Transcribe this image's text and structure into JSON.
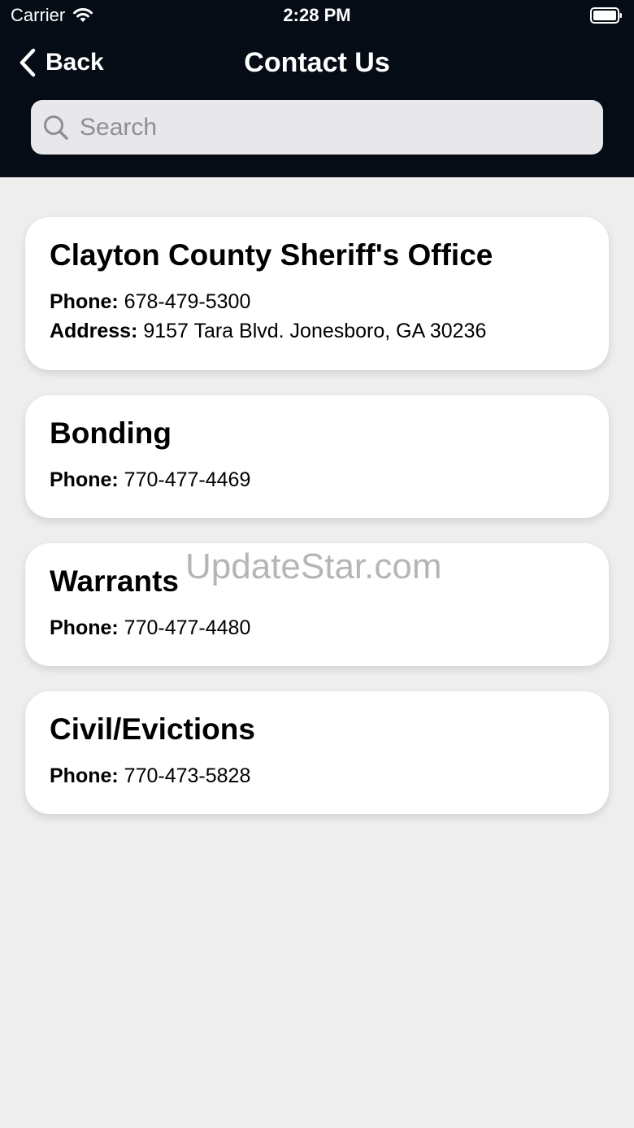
{
  "status_bar": {
    "carrier": "Carrier",
    "time": "2:28 PM",
    "wifi_icon": "wifi-icon",
    "battery_icon": "battery-icon"
  },
  "nav": {
    "back_label": "Back",
    "title": "Contact Us",
    "back_icon": "chevron-left-icon"
  },
  "search": {
    "placeholder": "Search",
    "value": "",
    "icon": "search-icon"
  },
  "contacts": [
    {
      "name": "Clayton County Sheriff's Office",
      "phone_label": "Phone:",
      "phone": "678-479-5300",
      "address_label": "Address:",
      "address": "9157 Tara Blvd. Jonesboro, GA 30236"
    },
    {
      "name": "Bonding",
      "phone_label": "Phone:",
      "phone": "770-477-4469"
    },
    {
      "name": "Warrants",
      "phone_label": "Phone:",
      "phone": "770-477-4480"
    },
    {
      "name": "Civil/Evictions",
      "phone_label": "Phone:",
      "phone": "770-473-5828"
    }
  ],
  "watermark": "UpdateStar.com",
  "colors": {
    "header_bg": "#050c16",
    "page_bg": "#eeeeee",
    "card_bg": "#ffffff",
    "search_bg": "#e8e8ea"
  }
}
